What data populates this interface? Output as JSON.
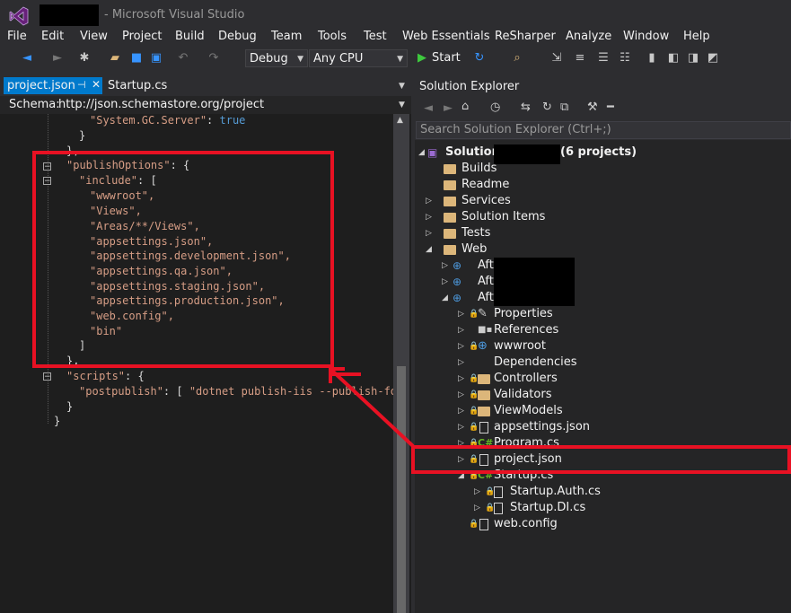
{
  "window": {
    "title": "- Microsoft Visual Studio"
  },
  "menu": [
    "File",
    "Edit",
    "View",
    "Project",
    "Build",
    "Debug",
    "Team",
    "Tools",
    "Test",
    "Web Essentials",
    "ReSharper",
    "Analyze",
    "Window",
    "Help"
  ],
  "toolbar": {
    "config": "Debug",
    "platform": "Any CPU",
    "start_label": "Start"
  },
  "editor": {
    "tabs": [
      "project.json",
      "Startup.cs"
    ],
    "schema_label": "Schema:",
    "schema_url": "http://json.schemastore.org/project",
    "lines": [
      "\"System.GC.Server\": true",
      "}",
      "},",
      "\"publishOptions\": {",
      "\"include\": [",
      "\"wwwroot\",",
      "\"Views\",",
      "\"Areas/**/Views\",",
      "\"appsettings.json\",",
      "\"appsettings.development.json\",",
      "\"appsettings.qa.json\",",
      "\"appsettings.staging.json\",",
      "\"appsettings.production.json\",",
      "\"web.config\",",
      "\"bin\"",
      "]",
      "},",
      "\"scripts\": {",
      "\"postpublish\": [ \"dotnet publish-iis --publish-fol",
      "}",
      "}"
    ]
  },
  "solution_explorer": {
    "title": "Solution Explorer",
    "search_placeholder": "Search Solution Explorer (Ctrl+;)",
    "solution_prefix": "Solution",
    "solution_suffix": "(6 projects)",
    "items": [
      "Builds",
      "Readme",
      "Services",
      "Solution Items",
      "Tests",
      "Web",
      "Aft.",
      "Aft.",
      "Aft.",
      "Properties",
      "References",
      "wwwroot",
      "Dependencies",
      "Controllers",
      "Validators",
      "ViewModels",
      "appsettings.json",
      "Program.cs",
      "project.json",
      "Startup.cs",
      "Startup.Auth.cs",
      "Startup.DI.cs",
      "web.config"
    ]
  },
  "colors": {
    "accent": "#007acc",
    "highlight": "#e81123"
  }
}
